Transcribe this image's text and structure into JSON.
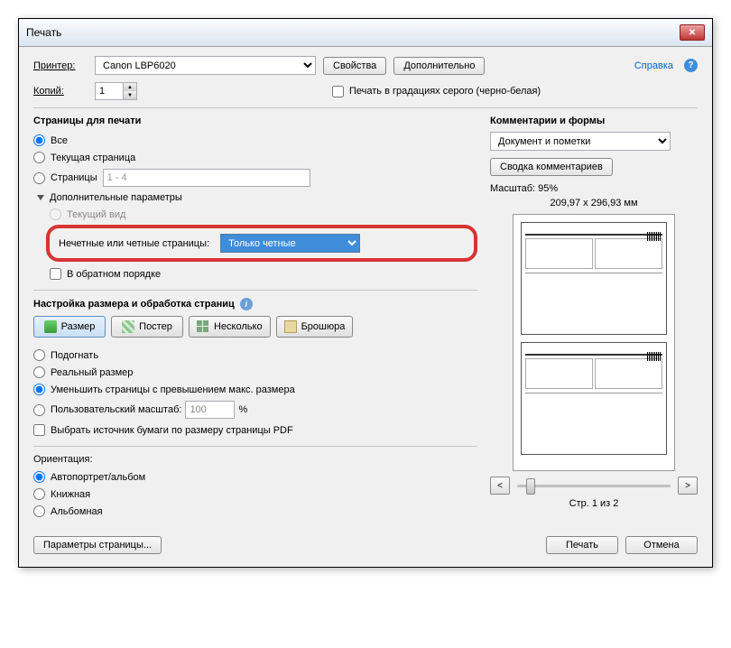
{
  "window": {
    "title": "Печать"
  },
  "header": {
    "printer_label": "Принтер:",
    "printer_value": "Canon LBP6020",
    "properties_btn": "Свойства",
    "advanced_btn": "Дополнительно",
    "help_link": "Справка",
    "copies_label": "Копий:",
    "copies_value": "1",
    "grayscale_label": "Печать в градациях серого (черно-белая)"
  },
  "pages": {
    "title": "Страницы для печати",
    "all": "Все",
    "current": "Текущая страница",
    "pages_label": "Страницы",
    "pages_value": "1 - 4",
    "more_params": "Дополнительные параметры",
    "current_view": "Текущий вид",
    "odd_even_label": "Нечетные или четные страницы:",
    "odd_even_value": "Только четные",
    "reverse_order": "В обратном порядке"
  },
  "sizing": {
    "title": "Настройка размера и обработка страниц",
    "size_btn": "Размер",
    "poster_btn": "Постер",
    "multiple_btn": "Несколько",
    "booklet_btn": "Брошюра",
    "fit": "Подогнать",
    "actual": "Реальный размер",
    "shrink": "Уменьшить страницы с превышением макс. размера",
    "custom_scale": "Пользовательский масштаб:",
    "custom_scale_value": "100",
    "custom_scale_unit": "%",
    "paper_source": "Выбрать источник бумаги по размеру страницы PDF"
  },
  "orientation": {
    "title": "Ориентация:",
    "auto": "Автопортрет/альбом",
    "portrait": "Книжная",
    "landscape": "Альбомная"
  },
  "comments": {
    "title": "Комментарии и формы",
    "value": "Документ и пометки",
    "summary_btn": "Сводка комментариев"
  },
  "preview": {
    "scale_label": "Масштаб: 95%",
    "dimensions": "209,97 x 296,93 мм",
    "prev": "<",
    "next": ">",
    "page_info": "Стр. 1 из 2"
  },
  "footer": {
    "page_setup": "Параметры страницы...",
    "print_btn": "Печать",
    "cancel_btn": "Отмена"
  }
}
